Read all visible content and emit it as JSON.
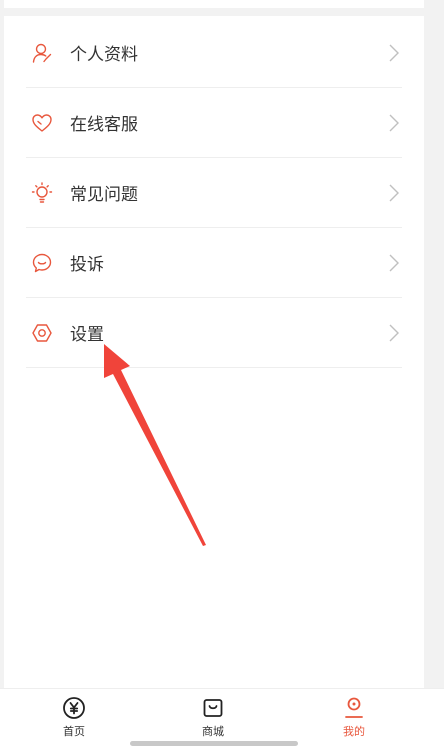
{
  "colors": {
    "accent": "#e8573d",
    "text": "#333333",
    "chevron": "#c0c0c0",
    "annotation_arrow": "#f0443a"
  },
  "menu": {
    "items": [
      {
        "label": "个人资料",
        "icon": "user-icon"
      },
      {
        "label": "在线客服",
        "icon": "heart-icon"
      },
      {
        "label": "常见问题",
        "icon": "lightbulb-icon"
      },
      {
        "label": "投诉",
        "icon": "smile-chat-icon"
      },
      {
        "label": "设置",
        "icon": "gear-icon"
      }
    ]
  },
  "tabbar": {
    "tabs": [
      {
        "label": "首页",
        "icon": "yen-coin-icon",
        "active": false
      },
      {
        "label": "商城",
        "icon": "shopping-bag-icon",
        "active": false
      },
      {
        "label": "我的",
        "icon": "profile-icon",
        "active": true
      }
    ]
  }
}
